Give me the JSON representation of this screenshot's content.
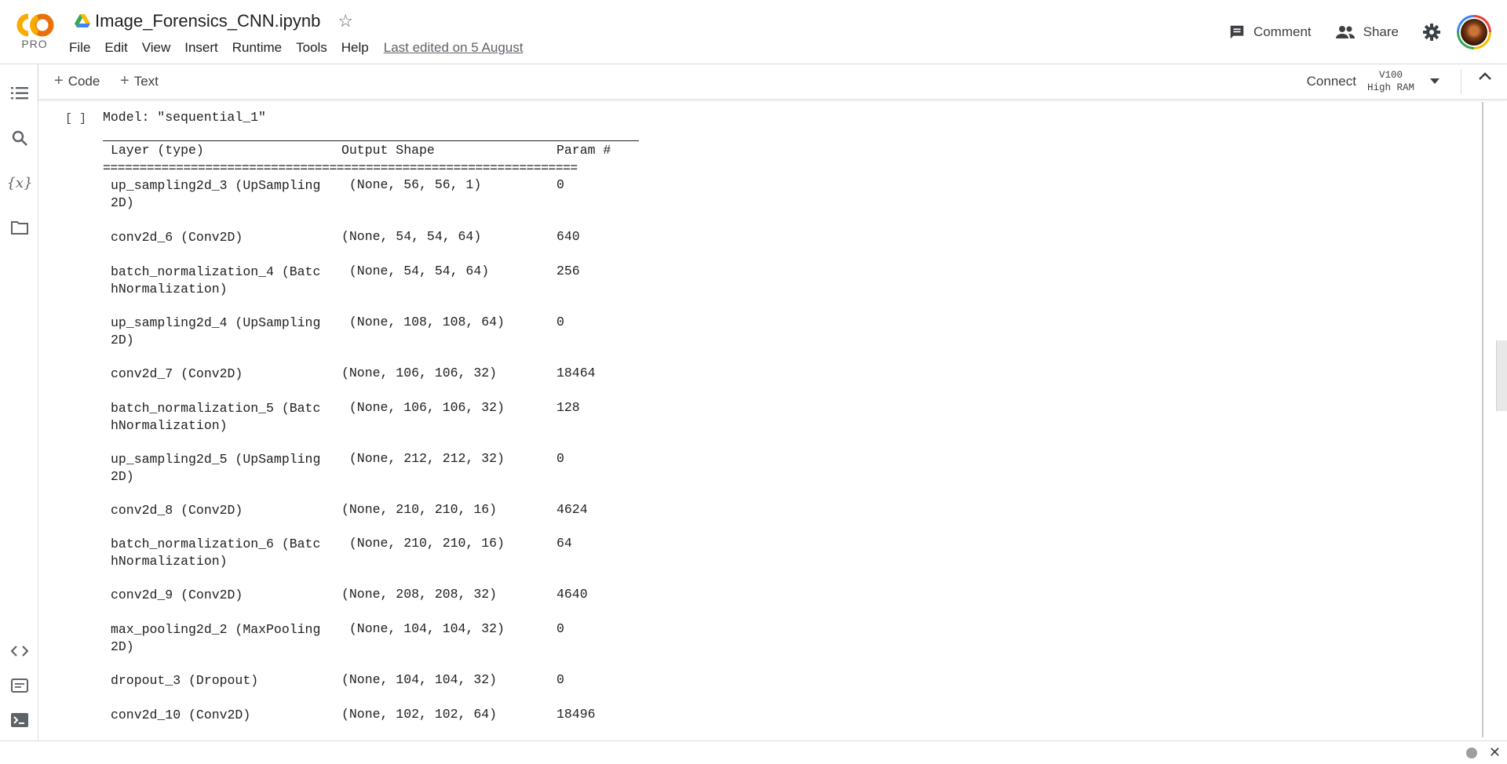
{
  "brand": {
    "logo_text": "CO",
    "tier": "PRO",
    "logo_colors": [
      "#f9ab00",
      "#e8710a"
    ]
  },
  "notebook": {
    "title": "Image_Forensics_CNN.ipynb",
    "last_edited": "Last edited on 5 August"
  },
  "menu": [
    "File",
    "Edit",
    "View",
    "Insert",
    "Runtime",
    "Tools",
    "Help"
  ],
  "header_actions": {
    "comment": "Comment",
    "share": "Share"
  },
  "toolbar": {
    "code": "Code",
    "text": "Text",
    "connect": "Connect",
    "runtime_gpu": "V100",
    "runtime_ram": "High RAM"
  },
  "icons": {
    "rail": [
      "table-of-contents-icon",
      "search-icon",
      "variables-icon",
      "files-icon",
      "code-snippets-icon",
      "command-palette-icon",
      "terminal-icon"
    ],
    "rail_variables_glyph": "{x}"
  },
  "cell": {
    "run_indicator": "[ ]",
    "model_title": "Model: \"sequential_1\"",
    "columns": [
      "Layer (type)",
      "Output Shape",
      "Param #"
    ],
    "double_rule": "=================================================================",
    "rows": [
      {
        "layer": "up_sampling2d_3 (UpSampling\n2D)",
        "shape": " (None, 56, 56, 1)",
        "params": "0"
      },
      {
        "layer": "conv2d_6 (Conv2D)",
        "shape": "(None, 54, 54, 64)",
        "params": "640"
      },
      {
        "layer": "batch_normalization_4 (Batc\nhNormalization)",
        "shape": " (None, 54, 54, 64)",
        "params": "256"
      },
      {
        "layer": "up_sampling2d_4 (UpSampling\n2D)",
        "shape": " (None, 108, 108, 64)",
        "params": "0"
      },
      {
        "layer": "conv2d_7 (Conv2D)",
        "shape": "(None, 106, 106, 32)",
        "params": "18464"
      },
      {
        "layer": "batch_normalization_5 (Batc\nhNormalization)",
        "shape": " (None, 106, 106, 32)",
        "params": "128"
      },
      {
        "layer": "up_sampling2d_5 (UpSampling\n2D)",
        "shape": " (None, 212, 212, 32)",
        "params": "0"
      },
      {
        "layer": "conv2d_8 (Conv2D)",
        "shape": "(None, 210, 210, 16)",
        "params": "4624"
      },
      {
        "layer": "batch_normalization_6 (Batc\nhNormalization)",
        "shape": " (None, 210, 210, 16)",
        "params": "64"
      },
      {
        "layer": "conv2d_9 (Conv2D)",
        "shape": "(None, 208, 208, 32)",
        "params": "4640"
      },
      {
        "layer": "max_pooling2d_2 (MaxPooling\n2D)",
        "shape": " (None, 104, 104, 32)",
        "params": "0"
      },
      {
        "layer": "dropout_3 (Dropout)",
        "shape": "(None, 104, 104, 32)",
        "params": "0"
      },
      {
        "layer": "conv2d_10 (Conv2D)",
        "shape": "(None, 102, 102, 64)",
        "params": "18496"
      }
    ]
  }
}
